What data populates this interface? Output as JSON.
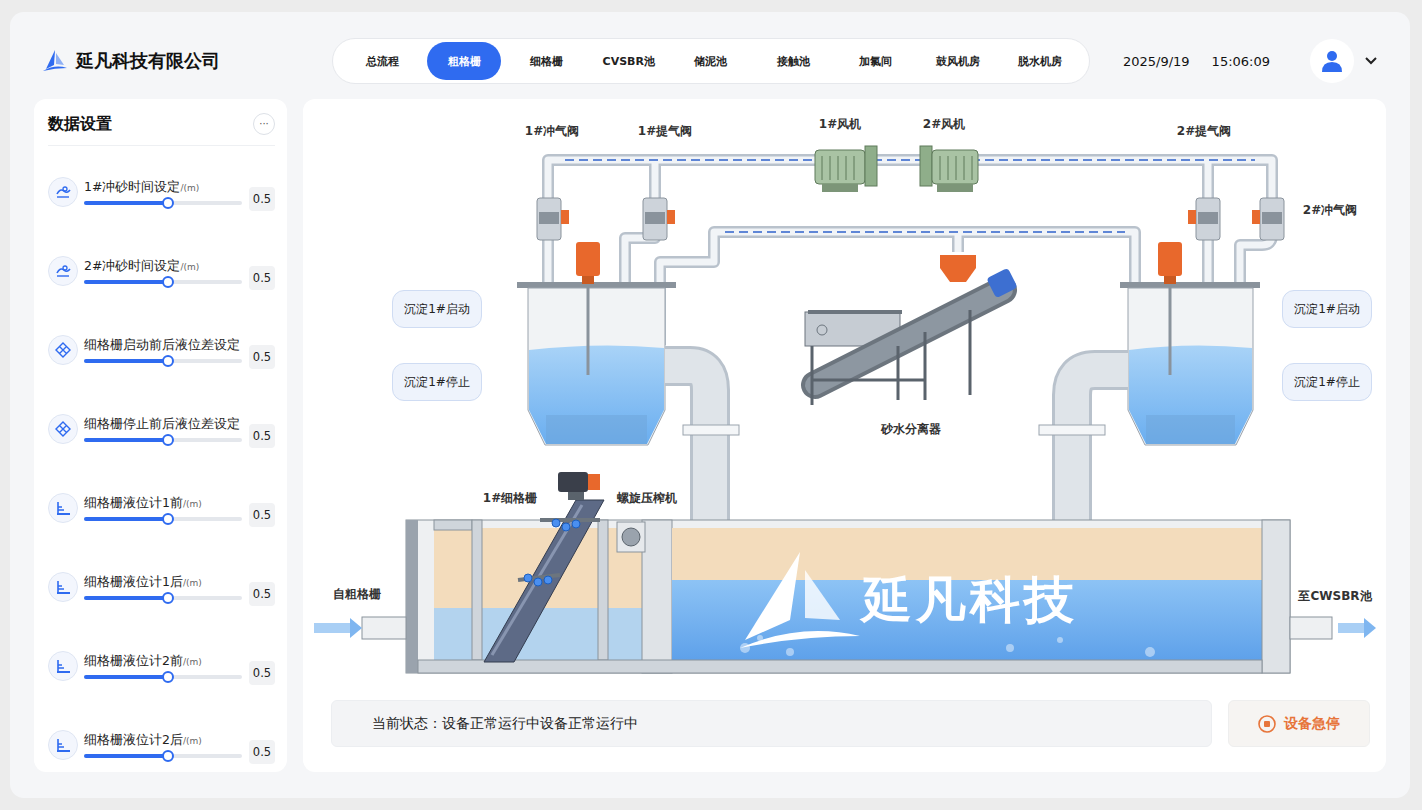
{
  "company": "延凡科技有限公司",
  "nav": [
    {
      "label": "总流程",
      "selected": false
    },
    {
      "label": "粗格栅",
      "selected": true
    },
    {
      "label": "细格栅",
      "selected": false
    },
    {
      "label": "CVSBR池",
      "selected": false
    },
    {
      "label": "储泥池",
      "selected": false
    },
    {
      "label": "接触池",
      "selected": false
    },
    {
      "label": "加氯间",
      "selected": false
    },
    {
      "label": "鼓风机房",
      "selected": false
    },
    {
      "label": "脱水机房",
      "selected": false
    }
  ],
  "header": {
    "date": "2025/9/19",
    "time": "15:06:09"
  },
  "sidebar": {
    "title": "数据设置",
    "more": "···",
    "items": [
      {
        "label": "1#冲砂时间设定",
        "unit": "/(m)",
        "value": "0.5",
        "level": 0.53,
        "kind": "wave"
      },
      {
        "label": "2#冲砂时间设定",
        "unit": "/(m)",
        "value": "0.5",
        "level": 0.53,
        "kind": "wave"
      },
      {
        "label": "细格栅启动前后液位差设定",
        "value": "0.5",
        "level": 0.53,
        "kind": "grid"
      },
      {
        "label": "细格栅停止前后液位差设定",
        "value": "0.5",
        "level": 0.53,
        "kind": "grid"
      },
      {
        "label": "细格栅液位计1前",
        "unit": "/(m)",
        "value": "0.5",
        "level": 0.53,
        "kind": "gauge"
      },
      {
        "label": "细格栅液位计1后",
        "unit": "/(m)",
        "value": "0.5",
        "level": 0.53,
        "kind": "gauge"
      },
      {
        "label": "细格栅液位计2前",
        "unit": "/(m)",
        "value": "0.5",
        "level": 0.53,
        "kind": "gauge"
      },
      {
        "label": "细格栅液位计2后",
        "unit": "/(m)",
        "value": "0.5",
        "level": 0.53,
        "kind": "gauge"
      }
    ]
  },
  "diagram": {
    "labels": [
      "1#冲气阀",
      "1#提气阀",
      "1#风机",
      "2#风机",
      "2#提气阀",
      "2#冲气阀",
      "砂水分离器",
      "1#细格栅",
      "螺旋压榨机",
      "自粗格栅",
      "至CWSBR池"
    ],
    "watermark": "延凡科技",
    "buttons": [
      "沉淀1#启动",
      "沉淀1#停止",
      "沉淀1#启动",
      "沉淀1#停止"
    ]
  },
  "status": {
    "label": "当前状态：",
    "text": "设备正常运行中设备正常运行中"
  },
  "estop": "设备急停"
}
